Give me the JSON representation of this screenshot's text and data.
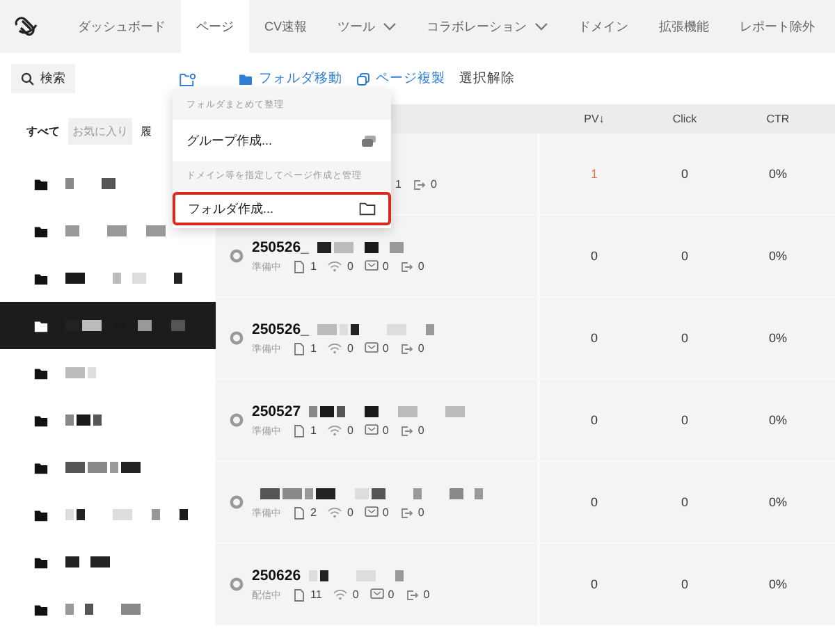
{
  "nav": {
    "tabs": [
      {
        "label": "ダッシュボード",
        "selected": false,
        "has_menu": false
      },
      {
        "label": "ページ",
        "selected": true,
        "has_menu": false
      },
      {
        "label": "CV速報",
        "selected": false,
        "has_menu": false
      },
      {
        "label": "ツール",
        "selected": false,
        "has_menu": true
      },
      {
        "label": "コラボレーション",
        "selected": false,
        "has_menu": true
      },
      {
        "label": "ドメイン",
        "selected": false,
        "has_menu": false
      },
      {
        "label": "拡張機能",
        "selected": false,
        "has_menu": false
      },
      {
        "label": "レポート除外",
        "selected": false,
        "has_menu": false
      }
    ]
  },
  "sidebar": {
    "search": {
      "label": "検索"
    },
    "filters": [
      {
        "label": "すべて",
        "selected": true,
        "muted": false
      },
      {
        "label": "お気に入り",
        "selected": false,
        "muted": true
      },
      {
        "label": "履",
        "selected": false,
        "muted": false
      }
    ],
    "folders": [
      {
        "selected": false
      },
      {
        "selected": false
      },
      {
        "selected": false
      },
      {
        "selected": true
      },
      {
        "selected": false
      },
      {
        "selected": false
      },
      {
        "selected": false
      },
      {
        "selected": false
      },
      {
        "selected": false
      },
      {
        "selected": false
      }
    ]
  },
  "toolbar": {
    "actions": [
      {
        "label": "フォルダ移動",
        "kind": "move"
      },
      {
        "label": "ページ複製",
        "kind": "copy"
      },
      {
        "label": "選択解除",
        "kind": "clear"
      }
    ]
  },
  "table": {
    "columns": [
      "PV↓",
      "Click",
      "CTR"
    ],
    "rows": [
      {
        "covered": true,
        "stats": [
          {
            "kind": "value_only",
            "value": "1"
          },
          {
            "kind": "exit",
            "value": "0"
          }
        ],
        "pv": "1",
        "pv_highlight": true,
        "click": "0",
        "ctr": "0%"
      },
      {
        "covered": false,
        "name": "250526_",
        "status": "準備中",
        "stats": [
          {
            "kind": "pages",
            "value": "1"
          },
          {
            "kind": "wifi",
            "value": "0"
          },
          {
            "kind": "mail",
            "value": "0"
          },
          {
            "kind": "exit",
            "value": "0"
          }
        ],
        "pv": "0",
        "pv_highlight": false,
        "click": "0",
        "ctr": "0%"
      },
      {
        "covered": false,
        "name": "250526_",
        "status": "準備中",
        "stats": [
          {
            "kind": "pages",
            "value": "1"
          },
          {
            "kind": "wifi",
            "value": "0"
          },
          {
            "kind": "mail",
            "value": "0"
          },
          {
            "kind": "exit",
            "value": "0"
          }
        ],
        "pv": "0",
        "pv_highlight": false,
        "click": "0",
        "ctr": "0%"
      },
      {
        "covered": false,
        "name": "250527",
        "status": "準備中",
        "stats": [
          {
            "kind": "pages",
            "value": "1"
          },
          {
            "kind": "wifi",
            "value": "0"
          },
          {
            "kind": "mail",
            "value": "0"
          },
          {
            "kind": "exit",
            "value": "0"
          }
        ],
        "pv": "0",
        "pv_highlight": false,
        "click": "0",
        "ctr": "0%"
      },
      {
        "covered": false,
        "status": "準備中",
        "stats": [
          {
            "kind": "pages",
            "value": "2"
          },
          {
            "kind": "wifi",
            "value": "0"
          },
          {
            "kind": "mail",
            "value": "0"
          },
          {
            "kind": "exit",
            "value": "0"
          }
        ],
        "pv": "0",
        "pv_highlight": false,
        "click": "0",
        "ctr": "0%"
      },
      {
        "covered": false,
        "name": "250626",
        "status": "配信中",
        "stats": [
          {
            "kind": "pages",
            "value": "11"
          },
          {
            "kind": "wifi",
            "value": "0"
          },
          {
            "kind": "mail",
            "value": "0"
          },
          {
            "kind": "exit",
            "value": "0"
          }
        ],
        "pv": "0",
        "pv_highlight": false,
        "click": "0",
        "ctr": "0%"
      }
    ]
  },
  "menu": {
    "sections": [
      {
        "header": "フォルダまとめて整理",
        "items": [
          {
            "label": "グループ作成...",
            "kind": "group",
            "highlighted": false
          }
        ]
      },
      {
        "header": "ドメイン等を指定してページ作成と管理",
        "items": [
          {
            "label": "フォルダ作成...",
            "kind": "folder",
            "highlighted": true
          }
        ]
      }
    ]
  }
}
